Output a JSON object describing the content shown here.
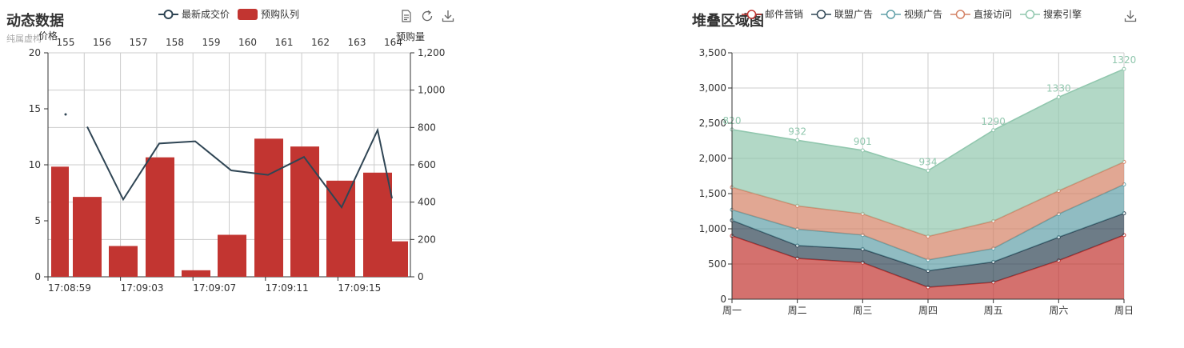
{
  "left_chart": {
    "title": "动态数据",
    "subtitle": "纯属虚构",
    "legend": [
      {
        "name": "最新成交价",
        "type": "line",
        "color": "#2f4554"
      },
      {
        "name": "预购队列",
        "type": "bar",
        "color": "#c23531"
      }
    ],
    "toolbox": [
      "data-view-icon",
      "refresh-icon",
      "download-icon"
    ],
    "colors": {
      "bar": "#c23531",
      "line": "#2f4554"
    },
    "chart_data": {
      "type": "bar",
      "title": "动态数据",
      "subtitle": "纯属虚构",
      "x_bottom_labels": [
        "17:08:59",
        "17:09:03",
        "17:09:07",
        "17:09:11",
        "17:09:15"
      ],
      "x_top_labels": [
        "155",
        "156",
        "157",
        "158",
        "159",
        "160",
        "161",
        "162",
        "163",
        "164"
      ],
      "y_left": {
        "name": "价格",
        "min": 0,
        "max": 20,
        "ticks": [
          "0",
          "5",
          "10",
          "15",
          "20"
        ]
      },
      "y_right": {
        "name": "预购量",
        "min": 0,
        "max": 1200,
        "ticks": [
          "0",
          "200",
          "400",
          "600",
          "800",
          "1,000",
          "1,200"
        ]
      },
      "series": [
        {
          "name": "预购队列",
          "type": "bar",
          "axis": "right",
          "values": [
            590,
            428,
            165,
            640,
            35,
            225,
            740,
            698,
            515,
            558,
            190
          ]
        },
        {
          "name": "最新成交价",
          "type": "line",
          "axis": "left",
          "values": [
            14.5,
            13.4,
            6.9,
            11.9,
            12.1,
            9.5,
            9.1,
            10.7,
            6.2,
            13.1,
            7.0
          ]
        }
      ],
      "grid": true
    }
  },
  "right_chart": {
    "title": "堆叠区域图",
    "legend": [
      {
        "name": "邮件营销",
        "color": "#c23531"
      },
      {
        "name": "联盟广告",
        "color": "#2f4554"
      },
      {
        "name": "视频广告",
        "color": "#61a0a8"
      },
      {
        "name": "直接访问",
        "color": "#d48265"
      },
      {
        "name": "搜索引擎",
        "color": "#91c7ae"
      }
    ],
    "toolbox": [
      "download-icon"
    ],
    "chart_data": {
      "type": "area",
      "title": "堆叠区域图",
      "categories": [
        "周一",
        "周二",
        "周三",
        "周四",
        "周五",
        "周六",
        "周日"
      ],
      "y": {
        "min": 0,
        "max": 3500,
        "ticks": [
          "0",
          "500",
          "1,000",
          "1,500",
          "2,000",
          "2,500",
          "3,000",
          "3,500"
        ]
      },
      "series": [
        {
          "name": "邮件营销",
          "color": "#c23531",
          "values": [
            900,
            580,
            520,
            170,
            240,
            550,
            910
          ]
        },
        {
          "name": "联盟广告",
          "color": "#2f4554",
          "values": [
            220,
            182,
            191,
            234,
            290,
            330,
            310
          ]
        },
        {
          "name": "视频广告",
          "color": "#61a0a8",
          "values": [
            150,
            232,
            201,
            154,
            190,
            330,
            410
          ]
        },
        {
          "name": "直接访问",
          "color": "#d48265",
          "values": [
            320,
            332,
            301,
            334,
            390,
            330,
            320
          ]
        },
        {
          "name": "搜索引擎",
          "color": "#91c7ae",
          "values": [
            820,
            932,
            901,
            934,
            1290,
            1330,
            1320
          ]
        }
      ],
      "top_labels": [
        "820",
        "932",
        "901",
        "934",
        "1290",
        "1330",
        "1320"
      ],
      "grid": true
    }
  }
}
